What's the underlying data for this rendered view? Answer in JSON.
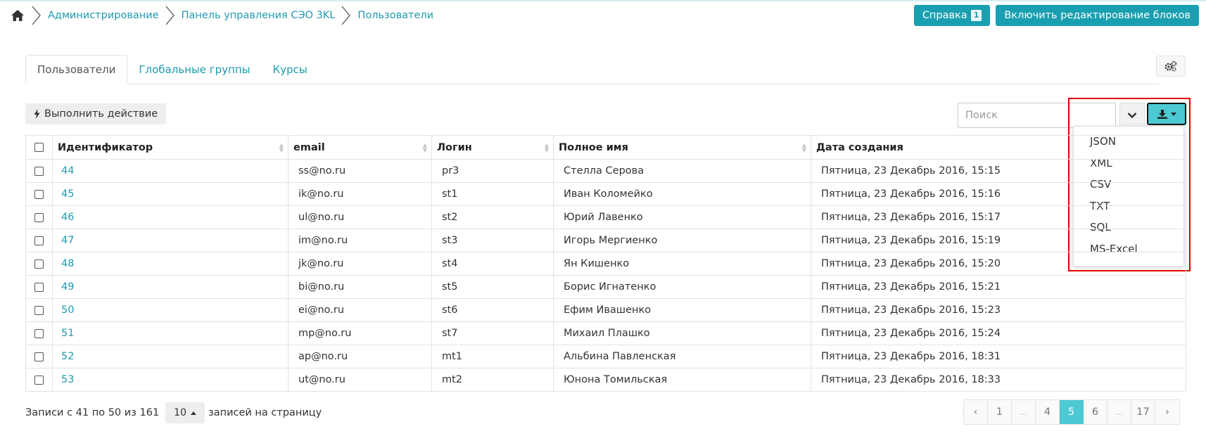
{
  "breadcrumb": {
    "items": [
      "Администрирование",
      "Панель управления СЭО 3KL",
      "Пользователи"
    ]
  },
  "top_buttons": {
    "help_label": "Справка",
    "help_badge": "1",
    "edit_blocks_label": "Включить редактирование блоков"
  },
  "tabs": [
    "Пользователи",
    "Глобальные группы",
    "Курсы"
  ],
  "actions": {
    "execute_label": "Выполнить действие"
  },
  "search": {
    "placeholder": "Поиск",
    "value": ""
  },
  "export_menu": {
    "items": [
      "JSON",
      "XML",
      "CSV",
      "TXT",
      "SQL",
      "MS-Excel"
    ]
  },
  "table": {
    "headers": [
      "Идентификатор",
      "email",
      "Логин",
      "Полное имя",
      "Дата создания"
    ],
    "rows": [
      {
        "id": "44",
        "email": "ss@no.ru",
        "login": "pr3",
        "name": "Стелла Серова",
        "created": "Пятница, 23 Декабрь 2016, 15:15"
      },
      {
        "id": "45",
        "email": "ik@no.ru",
        "login": "st1",
        "name": "Иван Коломейко",
        "created": "Пятница, 23 Декабрь 2016, 15:16"
      },
      {
        "id": "46",
        "email": "ul@no.ru",
        "login": "st2",
        "name": "Юрий Лавенко",
        "created": "Пятница, 23 Декабрь 2016, 15:17"
      },
      {
        "id": "47",
        "email": "im@no.ru",
        "login": "st3",
        "name": "Игорь Мергиенко",
        "created": "Пятница, 23 Декабрь 2016, 15:19"
      },
      {
        "id": "48",
        "email": "jk@no.ru",
        "login": "st4",
        "name": "Ян Кишенко",
        "created": "Пятница, 23 Декабрь 2016, 15:20"
      },
      {
        "id": "49",
        "email": "bi@no.ru",
        "login": "st5",
        "name": "Борис Игнатенко",
        "created": "Пятница, 23 Декабрь 2016, 15:21"
      },
      {
        "id": "50",
        "email": "ei@no.ru",
        "login": "st6",
        "name": "Ефим Ивашенко",
        "created": "Пятница, 23 Декабрь 2016, 15:23"
      },
      {
        "id": "51",
        "email": "mp@no.ru",
        "login": "st7",
        "name": "Михаил Плашко",
        "created": "Пятница, 23 Декабрь 2016, 15:24"
      },
      {
        "id": "52",
        "email": "ap@no.ru",
        "login": "mt1",
        "name": "Альбина Павленская",
        "created": "Пятница, 23 Декабрь 2016, 18:31"
      },
      {
        "id": "53",
        "email": "ut@no.ru",
        "login": "mt2",
        "name": "Юнона Томильская",
        "created": "Пятница, 23 Декабрь 2016, 18:33"
      }
    ]
  },
  "footer": {
    "records_text": "Записи с 41 по 50 из 161",
    "per_page_value": "10",
    "per_page_suffix": "записей на страницу"
  },
  "pagination": {
    "prev": "‹",
    "pages": [
      "1",
      "...",
      "4",
      "5",
      "6",
      "...",
      "17"
    ],
    "active": "5",
    "next": "›"
  },
  "colors": {
    "accent": "#1a9fb0",
    "link": "#1f9aae",
    "export_button": "#4cc9d3",
    "highlight_outline": "#e00000"
  }
}
